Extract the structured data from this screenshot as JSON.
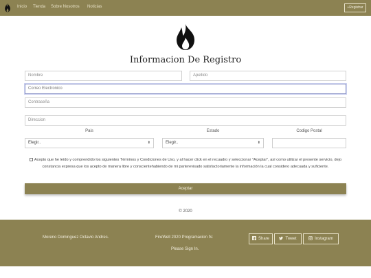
{
  "nav": {
    "logo_icon": "flame-icon",
    "links": [
      "Inicio",
      "Tienda",
      "Sobre Nosotros",
      "Noticias"
    ],
    "register_label": "+Registrar"
  },
  "form": {
    "title": "Informacion De Registro",
    "nombre_placeholder": "Nombre",
    "apellido_placeholder": "Apellido",
    "correo_placeholder": "Correo Electronico",
    "contrasena_placeholder": "Contraseña",
    "direccion_placeholder": "Direccion",
    "pais_label": "Pais",
    "estado_label": "Estado",
    "codigo_postal_label": "Codigo Postal",
    "pais_value": "Elegir..",
    "estado_value": "Elegir..",
    "terms_text": "Acepto que he leído y comprendido los siguientes Términos y Condiciones de Uso, y al hacer click en el recuadro y seleccionar \"Aceptar\", así como utilizar el presente servicio, dejo constancia expresa que los acepto de manera libre y conscientehabiendo de mi parterevisado satisfactoriamente la información la cual considero adecuada y suficiente.",
    "accept_label": "Aceptar"
  },
  "copyright": "© 2020",
  "footer": {
    "author": "Moreno Dominguez Octavio Andres.",
    "project": "FireWell 2020 Programacion IV.",
    "signin": "Please Sign In.",
    "social": {
      "share": "Share",
      "tweet": "Tweet",
      "instagram": "Instagram"
    }
  },
  "colors": {
    "brand": "#8c8252",
    "nav_text": "#e8e2c8"
  }
}
